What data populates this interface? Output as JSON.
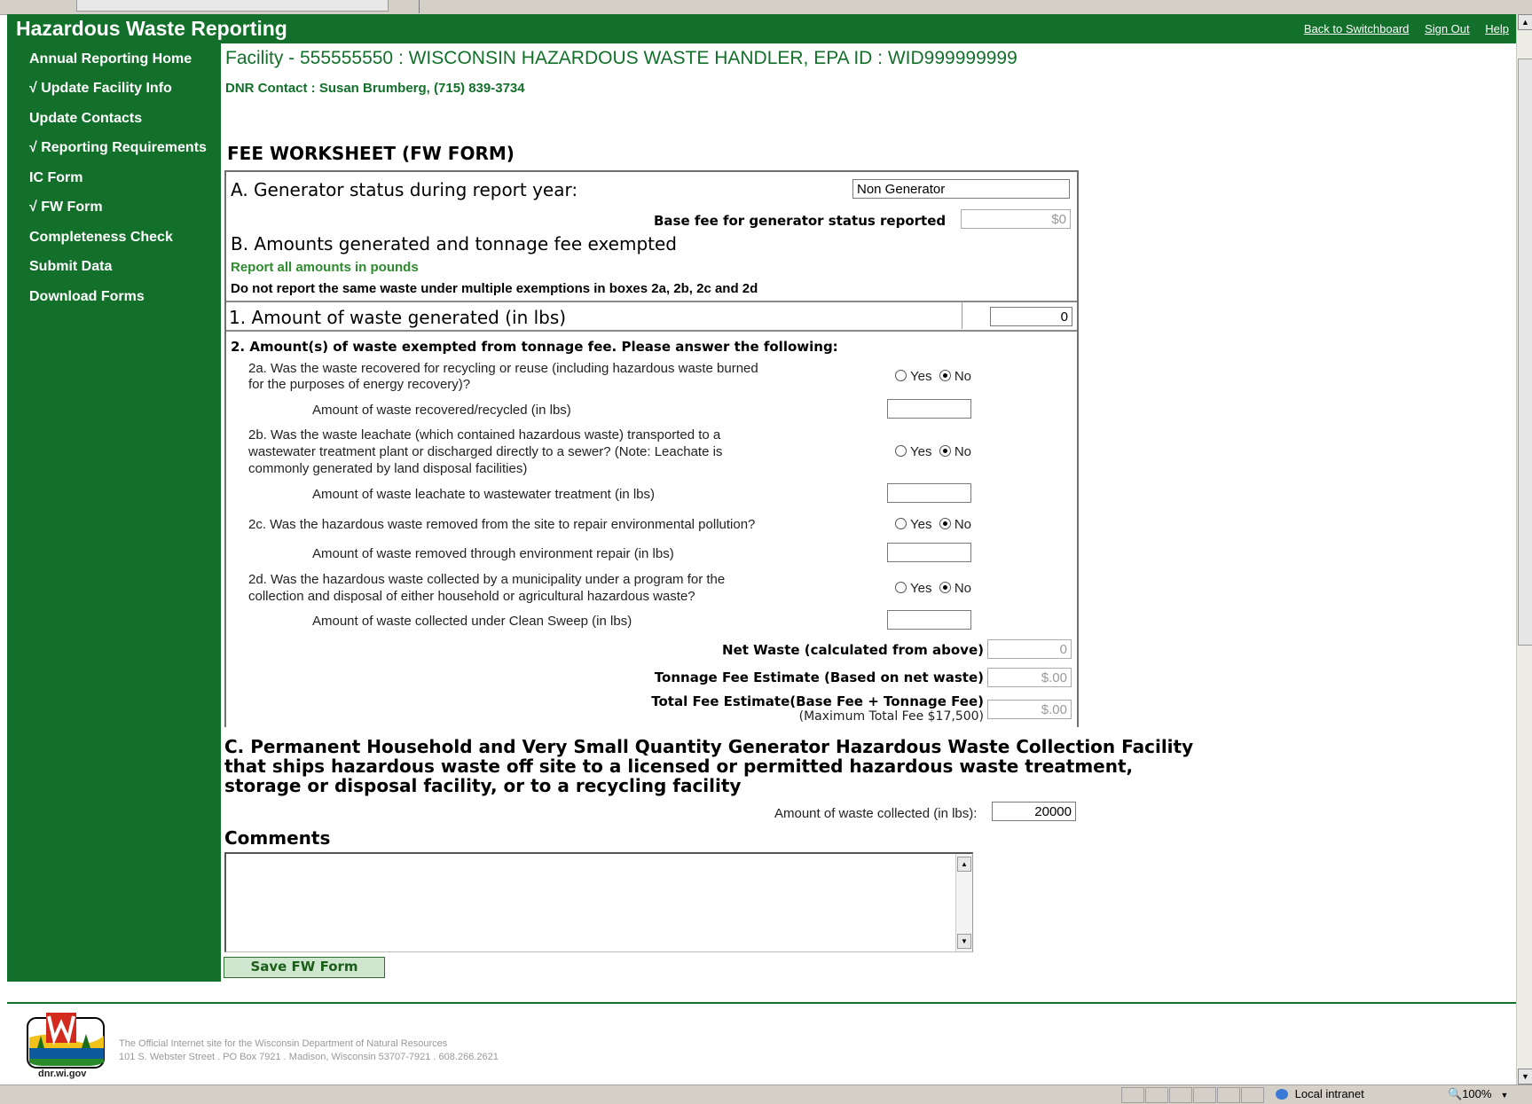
{
  "header": {
    "title": "Hazardous Waste Reporting",
    "links": {
      "switchboard": "Back to Switchboard",
      "signout": "Sign Out",
      "help": "Help"
    }
  },
  "sidebar": {
    "items": [
      {
        "label": "Annual Reporting Home"
      },
      {
        "label": "√ Update Facility Info"
      },
      {
        "label": "Update Contacts"
      },
      {
        "label": "√ Reporting Requirements"
      },
      {
        "label": "IC Form"
      },
      {
        "label": "√ FW Form"
      },
      {
        "label": "Completeness Check"
      },
      {
        "label": "Submit Data"
      },
      {
        "label": "Download Forms"
      }
    ]
  },
  "facility": {
    "line": "Facility - 555555550 : WISCONSIN HAZARDOUS WASTE HANDLER, EPA ID : WID999999999",
    "contact": "DNR Contact : Susan Brumberg, (715) 839-3734"
  },
  "form": {
    "title": "FEE WORKSHEET (FW FORM)",
    "sectionA": {
      "label": "A. Generator status during report year:",
      "status_value": "Non Generator",
      "base_fee_label": "Base fee for generator status reported",
      "base_fee_value": "$0"
    },
    "sectionB": {
      "heading": "B. Amounts generated and tonnage fee exempted",
      "note_green": "Report all amounts in pounds",
      "note": "Do not report the same waste under multiple exemptions in boxes 2a, 2b, 2c and 2d",
      "q1_label": "1. Amount of waste generated (in lbs)",
      "q1_value": "0",
      "q2_heading": "2. Amount(s) of waste exempted from tonnage fee. Please answer the following:",
      "q2a_line1": "2a. Was the waste recovered for recycling or reuse (including hazardous waste burned",
      "q2a_line2": "for the purposes of energy recovery)?",
      "q2a_amount": "Amount of waste recovered/recycled (in lbs)",
      "q2b_line1": "2b. Was the waste leachate (which contained hazardous waste) transported to a",
      "q2b_line2": "wastewater treatment plant or discharged directly to a sewer? (Note: Leachate is",
      "q2b_line3": "commonly generated by land disposal facilities)",
      "q2b_amount": "Amount of waste leachate to wastewater treatment (in lbs)",
      "q2c_line1": "2c. Was the hazardous waste removed from the site to repair environmental pollution?",
      "q2c_amount": "Amount of waste removed through environment repair (in lbs)",
      "q2d_line1": "2d. Was the hazardous waste collected by a municipality under a program for the",
      "q2d_line2": "collection and disposal of either household or agricultural hazardous waste?",
      "q2d_amount": "Amount of waste collected under Clean Sweep (in lbs)",
      "yes": "Yes",
      "no": "No",
      "net_label": "Net Waste (calculated from above)",
      "net_value": "0",
      "tonnage_label": "Tonnage Fee Estimate (Based on net waste)",
      "tonnage_value": "$.00",
      "total_label": "Total Fee Estimate(Base Fee + Tonnage Fee)",
      "total_sub": "(Maximum Total Fee $17,500)",
      "total_value": "$.00"
    },
    "sectionC": {
      "line1": "C. Permanent Household and Very Small Quantity Generator Hazardous Waste Collection Facility",
      "line2": "that ships hazardous waste off site to a licensed or permitted hazardous waste treatment,",
      "line3": "storage or disposal facility, or to a recycling facility",
      "amount_label": "Amount of waste collected (in lbs):",
      "amount_value": "20000"
    },
    "comments_label": "Comments",
    "save_button": "Save FW Form"
  },
  "footer": {
    "line1": "The Official Internet site for the Wisconsin Department of Natural Resources",
    "line2": "101 S. Webster Street . PO Box 7921 . Madison, Wisconsin 53707-7921 . 608.266.2621",
    "logo_label": "dnr.wi.gov"
  },
  "statusbar": {
    "zone": "Local intranet",
    "zoom": "100%"
  },
  "colors": {
    "brand_green": "#12702a"
  }
}
